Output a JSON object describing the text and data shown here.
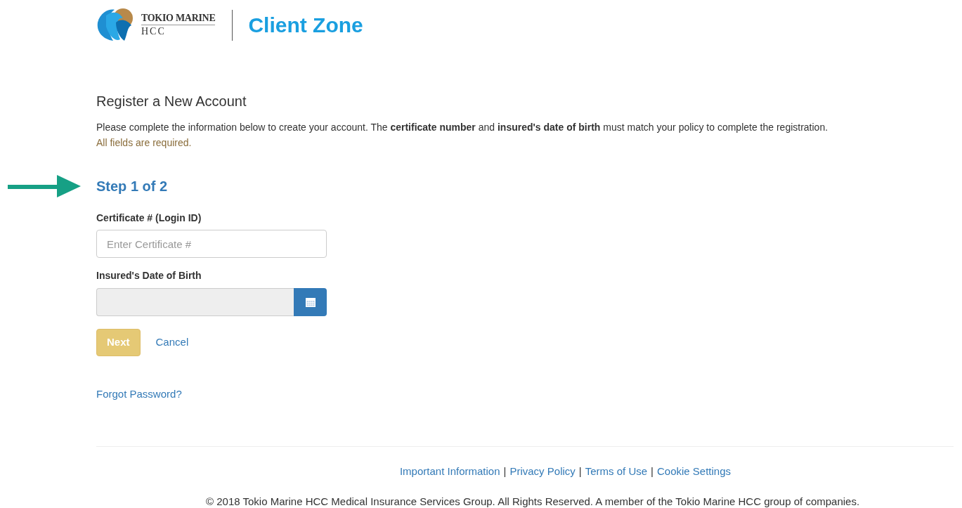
{
  "header": {
    "logo_line1": "TOKIO MARINE",
    "logo_line2": "HCC",
    "title": "Client Zone"
  },
  "form": {
    "title": "Register a New Account",
    "intro": "Please complete the information below to create your account. The **certificate number** and **insured's date of birth** must match your policy to complete the registration.",
    "required_note": "All fields are required.",
    "step": "Step 1 of 2",
    "fields": [
      {
        "kind": "text",
        "label": "Certificate # (Login ID)",
        "placeholder": "Enter Certificate #",
        "disabled": false
      },
      {
        "kind": "date",
        "label": "Insured's Date of Birth",
        "disabled": true
      }
    ],
    "next_button": {
      "label": "Next",
      "disabled": true
    },
    "cancel_link": "Cancel",
    "forgot_link": "Forgot Password?"
  },
  "footer": {
    "items": [
      {
        "kind": "link",
        "text": "Important Information"
      },
      {
        "kind": "separator",
        "text": "|"
      },
      {
        "kind": "link",
        "text": "Privacy Policy"
      },
      {
        "kind": "separator",
        "text": "|"
      },
      {
        "kind": "link",
        "text": "Terms of Use"
      },
      {
        "kind": "separator",
        "text": "|"
      },
      {
        "kind": "link",
        "text": "Cookie Settings"
      }
    ],
    "copyright": "© 2018 Tokio Marine HCC Medical Insurance Services Group. All Rights Reserved. A member of the Tokio Marine HCC group of companies."
  }
}
